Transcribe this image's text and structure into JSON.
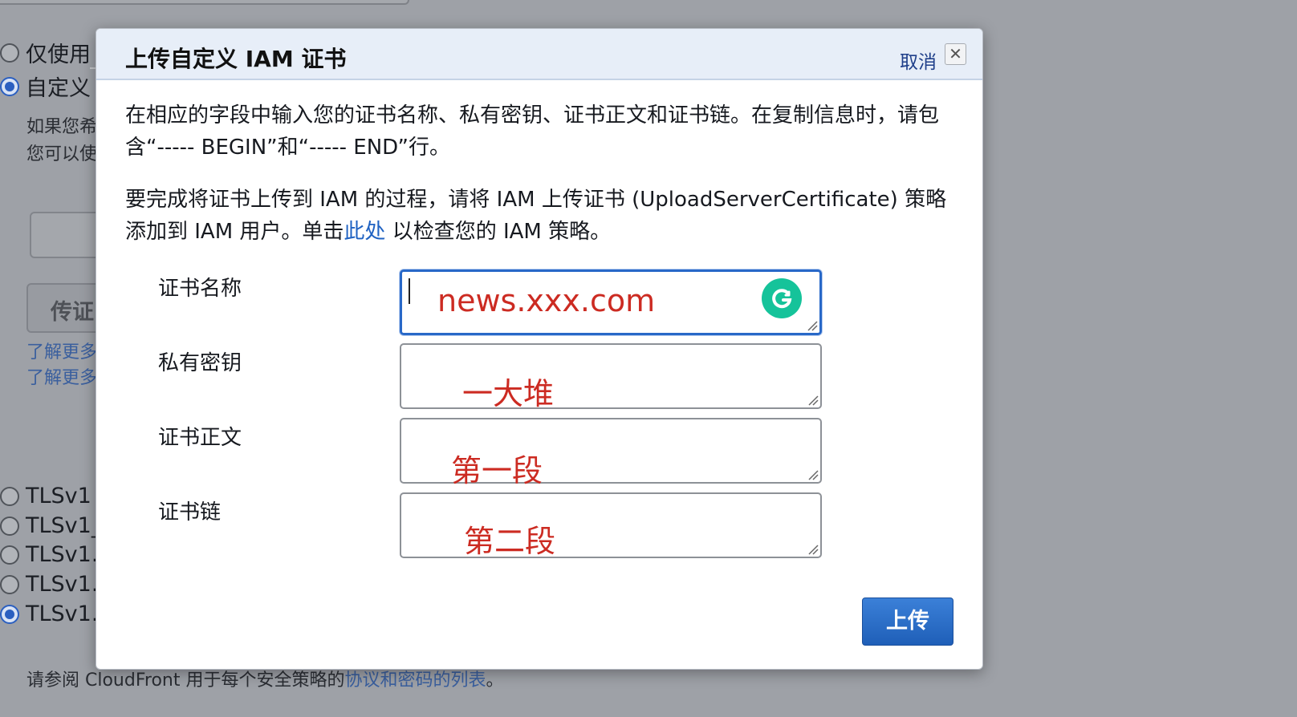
{
  "background": {
    "radio_options_top": [
      {
        "label": "仅使用",
        "checked": false
      },
      {
        "label": "自定义",
        "checked": true
      }
    ],
    "help_lines": [
      "如果您希",
      "您可以使"
    ],
    "button_label": "传证",
    "links": [
      "了解更多",
      "了解更多"
    ],
    "tls_options": [
      {
        "label": "TLSv1",
        "checked": false
      },
      {
        "label": "TLSv1_",
        "checked": false
      },
      {
        "label": "TLSv1.",
        "checked": false
      },
      {
        "label": "TLSv1.",
        "checked": false
      },
      {
        "label": "TLSv1.",
        "checked": true
      }
    ],
    "footer_prefix": "请参阅 CloudFront 用于每个安全策略的",
    "footer_link": "协议和密码的列表",
    "footer_suffix": "。"
  },
  "modal": {
    "title": "上传自定义 IAM 证书",
    "cancel_label": "取消",
    "close_symbol": "✕",
    "intro": "在相应的字段中输入您的证书名称、私有密钥、证书正文和证书链。在复制信息时，请包含“----- BEGIN”和“----- END”行。",
    "policy_before": "要完成将证书上传到 IAM 的过程，请将 IAM 上传证书 (UploadServerCertificate) 策略添加到 IAM 用户。单击",
    "policy_link": "此处",
    "policy_after": " 以检查您的 IAM 策略。",
    "fields": [
      {
        "label": "证书名称",
        "value": "news.xxx.com"
      },
      {
        "label": "私有密钥",
        "value": "一大堆"
      },
      {
        "label": "证书正文",
        "value": "第一段"
      },
      {
        "label": "证书链",
        "value": "第二段"
      }
    ],
    "upload_label": "上传",
    "colors": {
      "accent": "#2868c8",
      "annotation": "#cc2b22",
      "grammarly": "#15c39a"
    },
    "icons": [
      "close-icon",
      "grammarly-icon",
      "resize-handle-icon"
    ]
  }
}
